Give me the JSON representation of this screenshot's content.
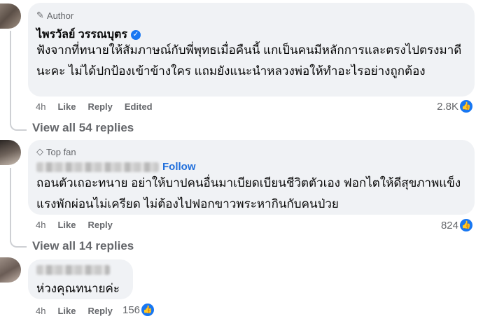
{
  "comments": [
    {
      "badge": "Author",
      "name": "ไพรวัลย์ วรรณบุตร",
      "text": "ฟังจากที่ทนายให้สัมภาษณ์กับพี่พุทธเมื่อคืนนี้ แกเป็นคนมีหลักการและตรงไปตรงมาดีนะคะ ไม่ได้ปกป้องเข้าข้างใคร แถมยังแนะนำหลวงพ่อให้ทำอะไรอย่างถูกต้อง",
      "time": "4h",
      "like": "Like",
      "reply": "Reply",
      "edited": "Edited",
      "reactions": "2.8K",
      "view_replies": "View all 54 replies"
    },
    {
      "badge": "Top fan",
      "follow": "Follow",
      "text": "ถอนตัวเถอะทนาย อย่าให้บาปคนอื่นมาเบียดเบียนชีวิตตัวเอง ฟอกไตให้ดีสุขภาพแข็งแรงพักผ่อนไม่เครียด ไม่ต้องไปฟอกขาวพระหากินกับคนป่วย",
      "time": "4h",
      "like": "Like",
      "reply": "Reply",
      "reactions": "824",
      "view_replies": "View all 14 replies"
    },
    {
      "text": "ห่วงคุณทนายค่ะ",
      "time": "4h",
      "like": "Like",
      "reply": "Reply",
      "reactions": "156"
    }
  ],
  "icons": {
    "author_badge": "pencil-icon",
    "topfan_badge": "diamond-icon",
    "verified": "verified-check-icon",
    "reaction": "thumbs-up-icon"
  },
  "colors": {
    "accent": "#1877f2",
    "bubble": "#f0f2f5",
    "muted": "#65676b"
  }
}
